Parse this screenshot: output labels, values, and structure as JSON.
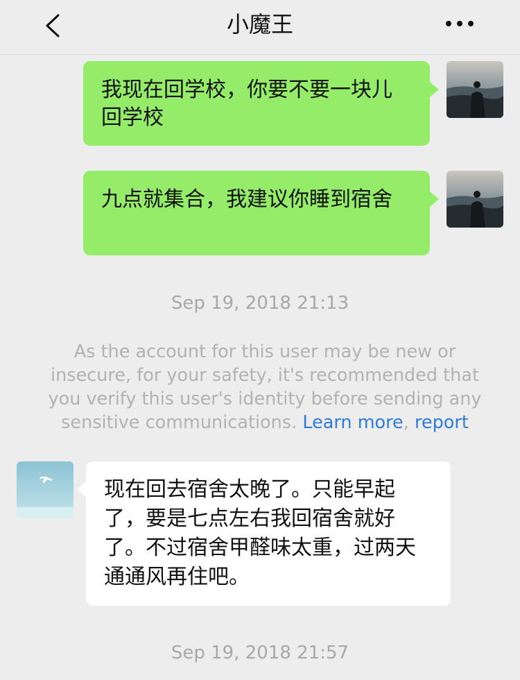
{
  "header": {
    "title": "小魔王",
    "back_icon": "chevron-left-icon",
    "more_icon": "more-horizontal-icon"
  },
  "messages": [
    {
      "direction": "outgoing",
      "text": "我现在回学校，你要不要一块儿回学校"
    },
    {
      "direction": "outgoing",
      "text": "九点就集合，我建议你睡到宿舍"
    },
    {
      "direction": "incoming",
      "text": "现在回去宿舍太晚了。只能早起了，要是七点左右我回宿舍就好了。不过宿舍甲醛味太重，过两天通通风再住吧。"
    }
  ],
  "timestamps": {
    "first": "Sep 19, 2018 21:13",
    "second": "Sep 19, 2018 21:57"
  },
  "notice": {
    "text": "As the account for this user may be new or insecure, for your safety, it's recommended that you verify this user's identity before sending any sensitive communications.",
    "learn_more": "Learn more",
    "separator": ",",
    "report": "report"
  },
  "colors": {
    "outgoing_bubble": "#95ec69",
    "incoming_bubble": "#ffffff",
    "background": "#ededed",
    "link": "#2f7bd8"
  }
}
